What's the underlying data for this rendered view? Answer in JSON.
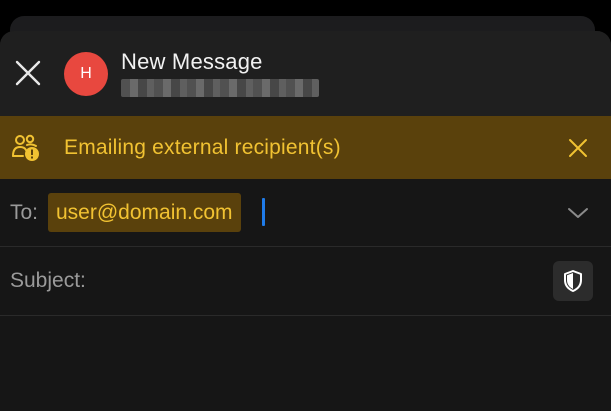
{
  "header": {
    "title": "New Message",
    "avatar_initial": "H",
    "avatar_color": "#e8483f",
    "close_icon": "close-icon"
  },
  "banner": {
    "text": "Emailing external recipient(s)",
    "icon": "people-warning-icon",
    "close_icon": "close-icon",
    "background": "#5a410c",
    "text_color": "#f1c232"
  },
  "to": {
    "label": "To:",
    "recipients": [
      "user@domain.com"
    ],
    "expand_icon": "chevron-down-icon"
  },
  "subject": {
    "label": "Subject:",
    "value": "",
    "sensitivity_icon": "shield-icon"
  },
  "colors": {
    "background": "#161616",
    "header": "#1f1f1f",
    "caret": "#1f7be8"
  }
}
